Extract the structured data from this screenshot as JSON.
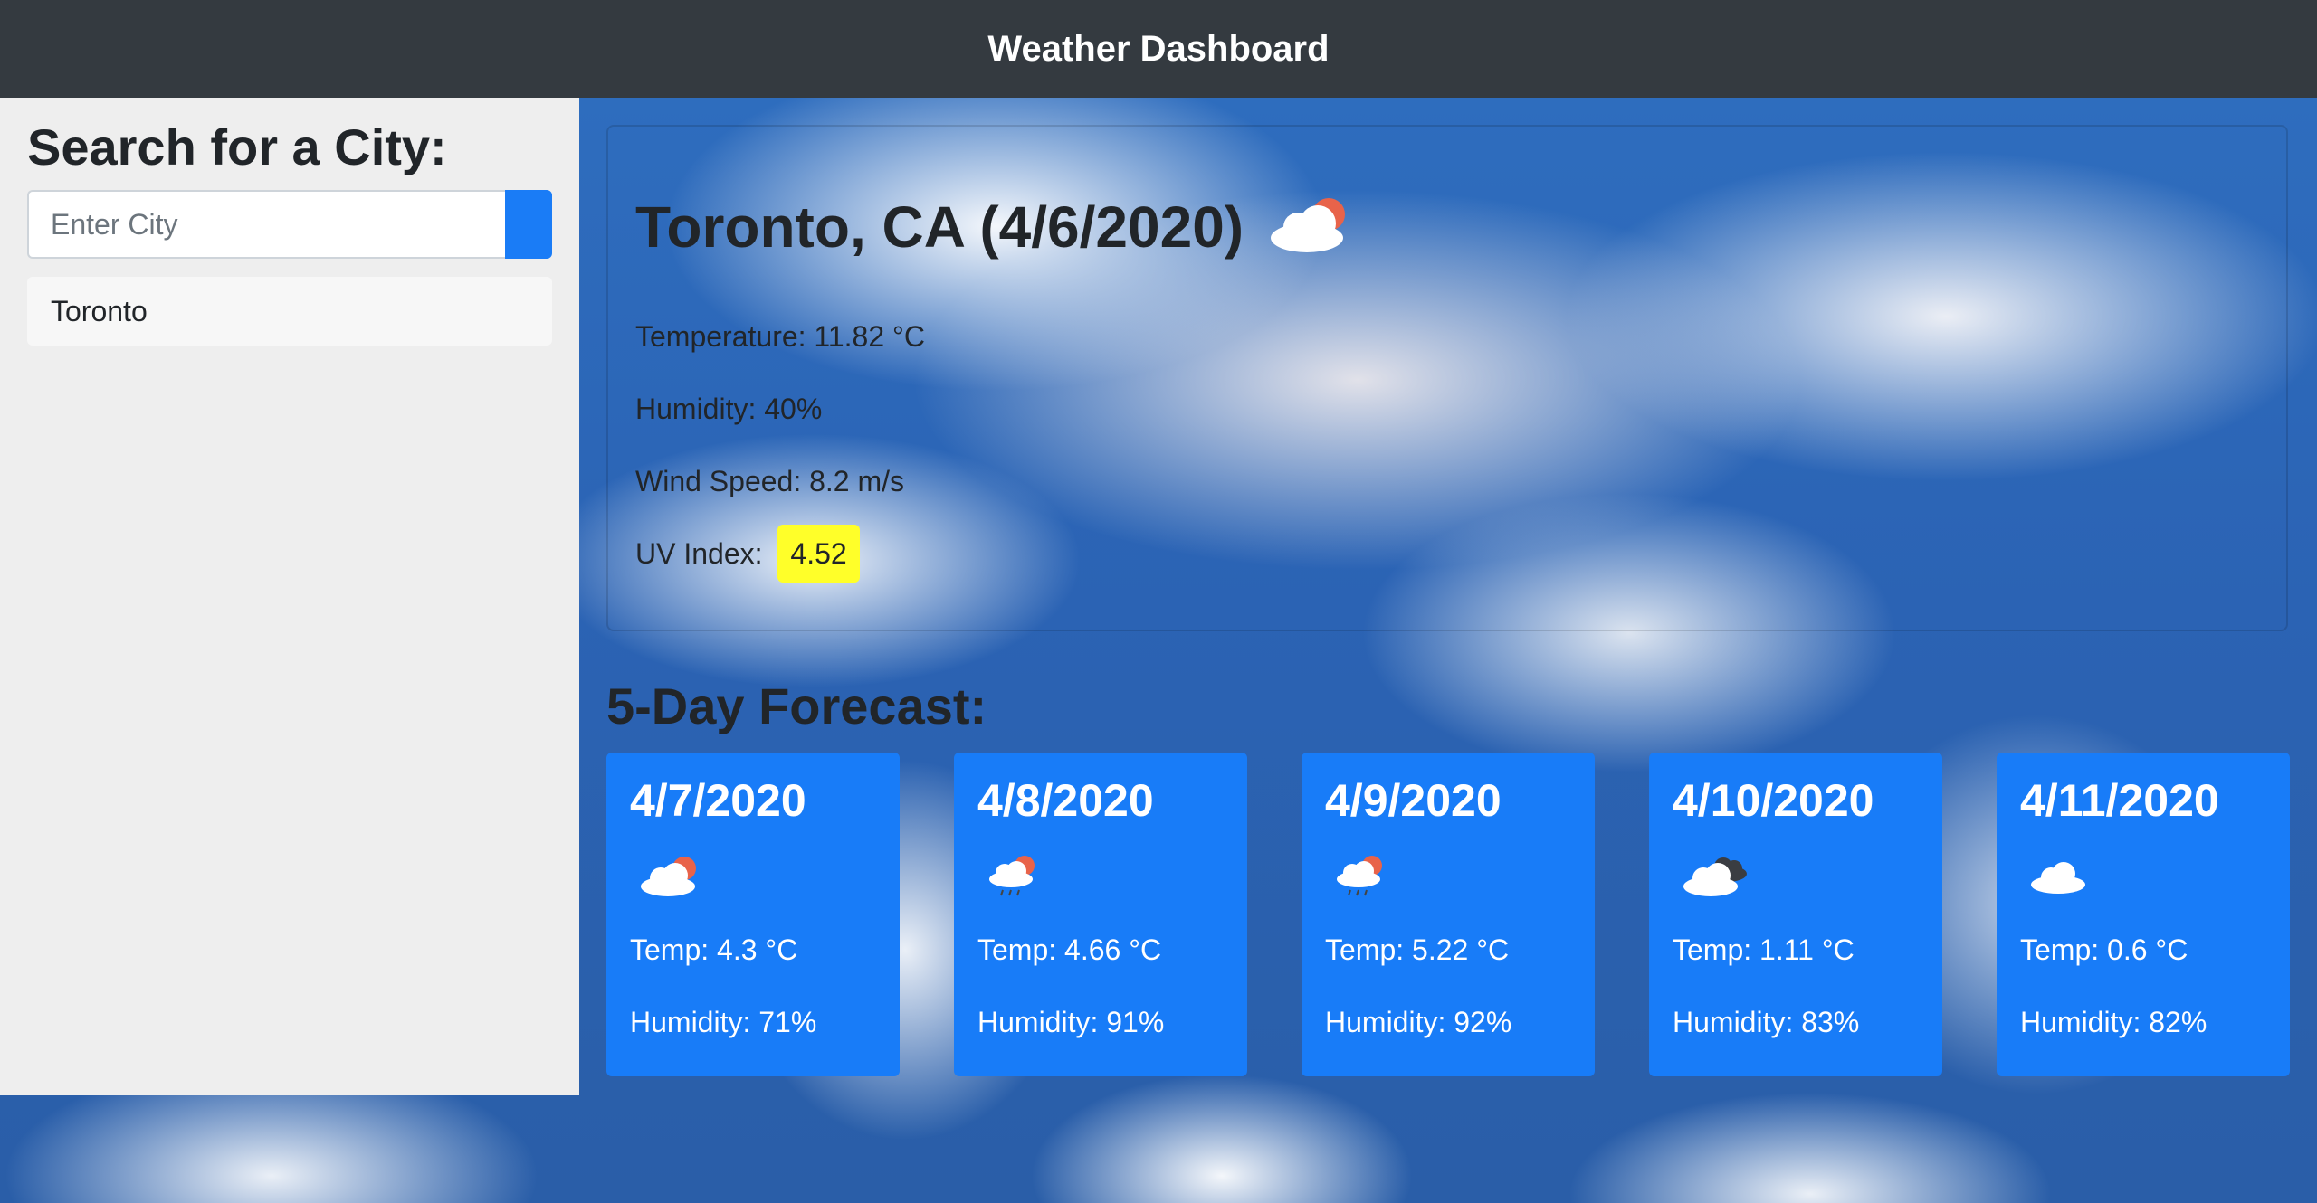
{
  "header": {
    "title": "Weather Dashboard"
  },
  "sidebar": {
    "heading": "Search for a City:",
    "search": {
      "placeholder": "Enter City",
      "value": ""
    },
    "history": [
      "Toronto"
    ]
  },
  "current": {
    "title": "Toronto, CA (4/6/2020)",
    "icon": "cloud-sun-icon",
    "temperature": "Temperature: 11.82 °C",
    "humidity": "Humidity: 40%",
    "wind": "Wind Speed: 8.2 m/s",
    "uv_label": "UV Index:",
    "uv_value": "4.52",
    "uv_color": "#ffff29"
  },
  "forecast": {
    "heading": "5-Day Forecast:",
    "days": [
      {
        "date": "4/7/2020",
        "icon": "cloud-sun-icon",
        "temp": "Temp: 4.3 °C",
        "humidity": "Humidity: 71%"
      },
      {
        "date": "4/8/2020",
        "icon": "rain-sun-icon",
        "temp": "Temp: 4.66 °C",
        "humidity": "Humidity: 91%"
      },
      {
        "date": "4/9/2020",
        "icon": "rain-sun-icon",
        "temp": "Temp: 5.22 °C",
        "humidity": "Humidity: 92%"
      },
      {
        "date": "4/10/2020",
        "icon": "broken-clouds-icon",
        "temp": "Temp: 1.11 °C",
        "humidity": "Humidity: 83%"
      },
      {
        "date": "4/11/2020",
        "icon": "cloud-icon",
        "temp": "Temp: 0.6 °C",
        "humidity": "Humidity: 82%"
      }
    ]
  },
  "colors": {
    "navbar": "#343a40",
    "accent": "#1a7cf6",
    "forecast_card": "#187cf8",
    "sidebar": "#eeeeee"
  }
}
